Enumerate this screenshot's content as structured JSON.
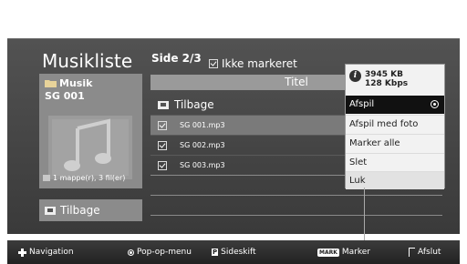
{
  "header": {
    "title": "Musikliste",
    "page": "Side 2/3",
    "unmarked_label": "Ikke markeret"
  },
  "folder_panel": {
    "folder_name": "Musik",
    "selected_title": "SG 001",
    "count": "1 mappe(r), 3 fil(er)"
  },
  "back_button": {
    "label": "Tilbage"
  },
  "list": {
    "header": "Titel",
    "up_item": "Tilbage",
    "files": [
      {
        "name": "SG 001.mp3",
        "selected": true
      },
      {
        "name": "SG 002.mp3",
        "selected": false
      },
      {
        "name": "SG 003.mp3",
        "selected": false
      }
    ]
  },
  "popup": {
    "size": "3945 KB",
    "bitrate": "128 Kbps",
    "items": [
      "Afspil",
      "Afspil med foto",
      "Marker alle",
      "Slet",
      "Luk"
    ],
    "active_item": "Afspil"
  },
  "footer": {
    "navigation": "Navigation",
    "popup_menu": "Pop-op-menu",
    "page_key": "P",
    "page_change": "Sideskift",
    "mark_key": "MARK",
    "mark": "Marker",
    "exit": "Afslut"
  },
  "icons": [
    "folder-icon",
    "music-note-icon",
    "back-folder-icon",
    "check-icon",
    "info-icon",
    "radio-selected-icon",
    "navigation-icon",
    "ok-icon",
    "exit-icon"
  ],
  "colors": {
    "panel": "#4a4a4a",
    "tile": "#8b8b8b",
    "popup_active": "#111111",
    "popup_bg": "#f2f2f2"
  }
}
